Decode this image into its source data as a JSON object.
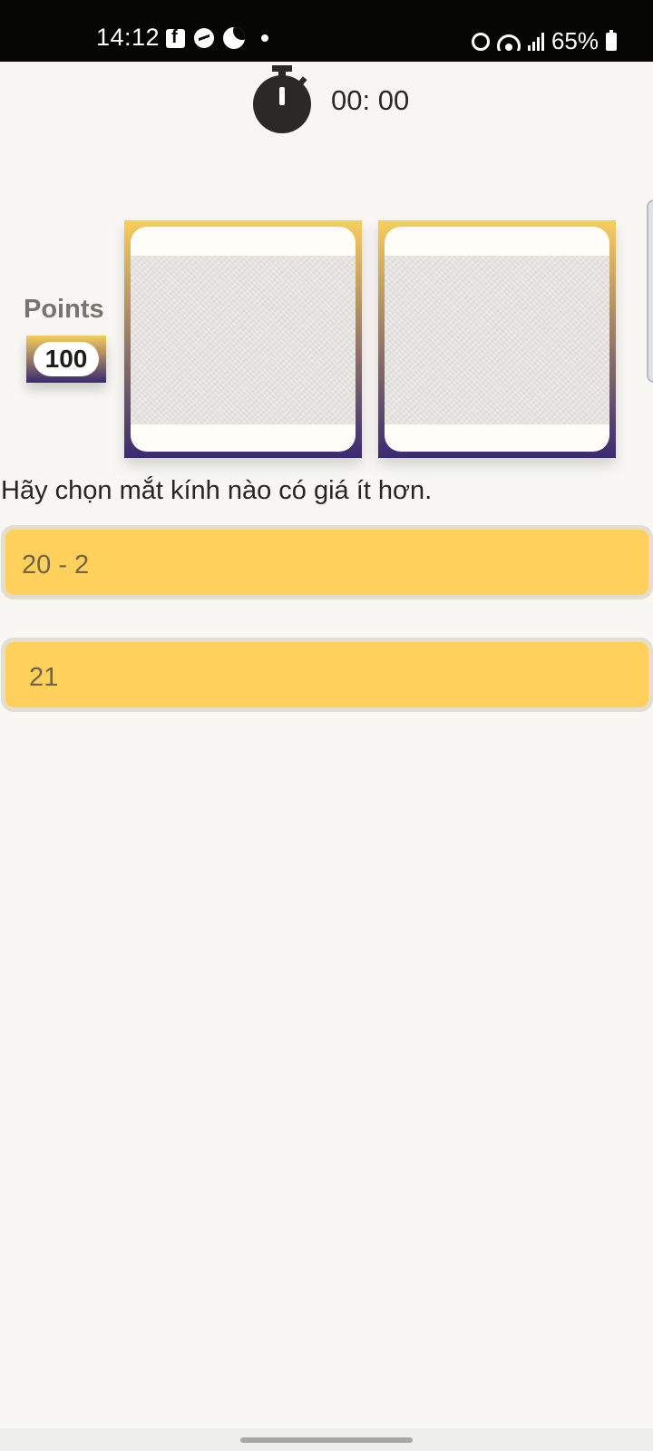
{
  "status_bar": {
    "time": "14:12",
    "battery": "65%"
  },
  "timer": {
    "value": "00: 00"
  },
  "points": {
    "label": "Points",
    "value": "100"
  },
  "question": {
    "text": "Hãy chọn mắt kính nào có giá ít hơn."
  },
  "answers": [
    {
      "label": "20 - 2"
    },
    {
      "label": "21"
    }
  ],
  "colors": {
    "background": "#f8f7f3",
    "answer_fill": "#ffd15c",
    "answer_border": "#e4ddd2",
    "gradient_top": "#f8cd5e",
    "gradient_bottom": "#3a2a70"
  }
}
